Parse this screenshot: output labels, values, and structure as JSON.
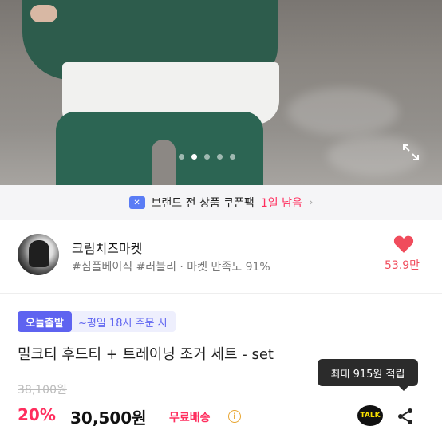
{
  "photo": {
    "slides": [
      false,
      true,
      false,
      false,
      false
    ],
    "expand_icon": "expand-icon"
  },
  "coupon": {
    "text_prefix": "브랜드 전 상품 쿠폰팩",
    "text_highlight": "1일 남음",
    "icon": "coupon-icon",
    "chevron": "›",
    "accent": "#ff2e5e"
  },
  "shop": {
    "name": "크림치즈마켓",
    "tags": "#심플베이직 #러블리 · 마켓 만족도 91%",
    "like_count": "53.9만",
    "heart_color": "#f04c5c"
  },
  "product": {
    "badge": "오늘출발",
    "badge_sub": "~평일 18시 주문 시",
    "title": "밀크티 후드티 + 트레이닝 조거 세트 - set",
    "original_price": "38,100원",
    "discount": "20%",
    "price": "30,500원",
    "shipping": "무료배송",
    "info_glyph": "i",
    "tooltip": "최대 915원 적립",
    "kakao_label": "TALK",
    "accent": "#5e63f0"
  }
}
